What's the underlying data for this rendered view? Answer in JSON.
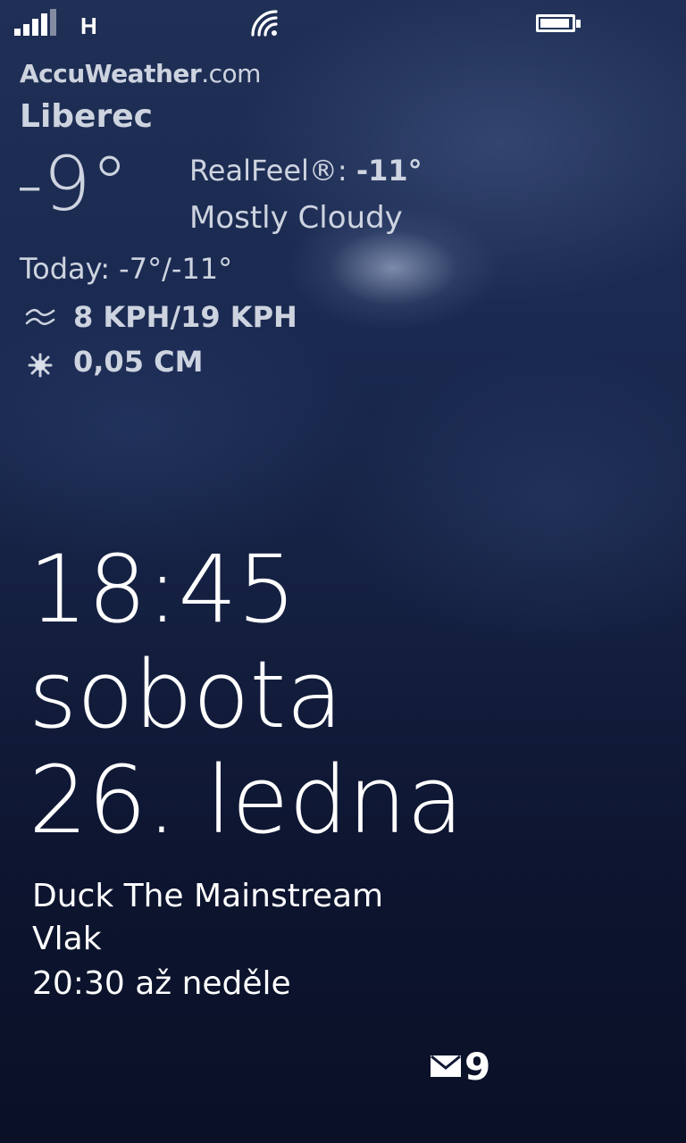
{
  "status_bar": {
    "signal_bars": 4,
    "network_type": "H",
    "wifi_icon": "wifi-icon",
    "battery_icon": "battery-icon",
    "battery_level": 0.95
  },
  "weather": {
    "brand_main": "AccuWeather",
    "brand_suffix": ".com",
    "city": "Liberec",
    "temperature": "-9°",
    "realfeel_label": "RealFeel®:",
    "realfeel_value": "-11°",
    "condition": "Mostly Cloudy",
    "today": "Today: -7°/-11°",
    "wind_icon": "wind-icon",
    "wind": "8 KPH/19 KPH",
    "snow_icon": "snowflake-icon",
    "snow": "0,05 CM"
  },
  "clock": {
    "time": "18:45",
    "day": "sobota",
    "date": "26. ledna"
  },
  "calendar": {
    "title": "Duck The Mainstream",
    "location": "Vlak",
    "when": "20:30 až neděle"
  },
  "notifications": {
    "mail_icon": "mail-icon",
    "mail_count": "9"
  },
  "colors": {
    "text": "#ffffff",
    "background_top": "#1f2f55",
    "background_bottom": "#0a1026"
  }
}
